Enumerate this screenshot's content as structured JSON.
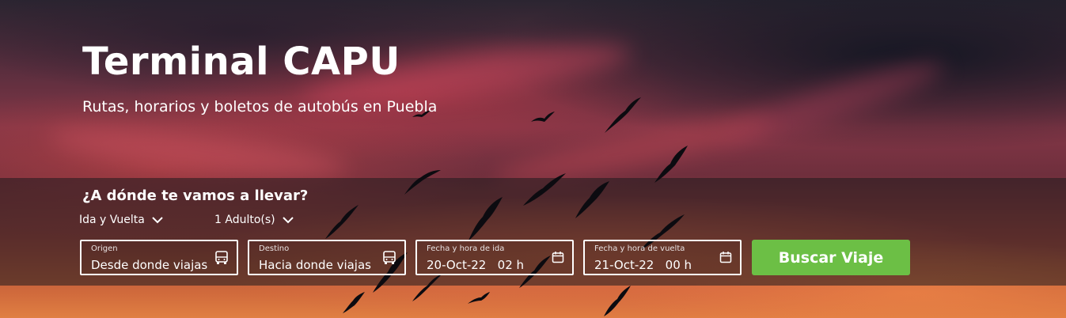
{
  "hero": {
    "title": "Terminal CAPU",
    "subtitle": "Rutas, horarios y boletos de autobús en Puebla"
  },
  "search": {
    "question": "¿A dónde te vamos a llevar?",
    "trip_type": "Ida y Vuelta",
    "passengers": "1 Adulto(s)",
    "origin": {
      "label": "Origen",
      "value": "Desde donde viajas",
      "icon": "bus-icon"
    },
    "destination": {
      "label": "Destino",
      "value": "Hacia donde viajas",
      "icon": "bus-icon"
    },
    "departure": {
      "label": "Fecha y hora de ida",
      "value": "20-Oct-22   02 h",
      "icon": "calendar-icon"
    },
    "return": {
      "label": "Fecha y hora de vuelta",
      "value": "21-Oct-22   00 h",
      "icon": "calendar-icon"
    },
    "button_label": "Buscar Viaje"
  },
  "colors": {
    "button": "#6cbf45",
    "text": "#ffffff",
    "overlay": "rgba(30,26,30,0.55)"
  }
}
